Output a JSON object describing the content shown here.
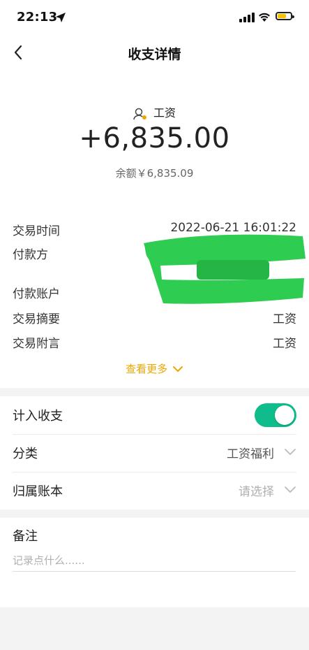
{
  "status": {
    "time": "22:13"
  },
  "nav": {
    "title": "收支详情"
  },
  "summary": {
    "category": "工资",
    "amount": "+6,835.00",
    "balance": "余额￥6,835.09"
  },
  "details": {
    "time_label": "交易时间",
    "time_value": "2022-06-21 16:01:22",
    "payer_label": "付款方",
    "payer_value": "",
    "account_label": "付款账户",
    "account_value": "",
    "summary_label": "交易摘要",
    "summary_value": "工资",
    "note_label": "交易附言",
    "note_value": "工资",
    "more": "查看更多"
  },
  "settings": {
    "income_label": "计入收支",
    "income_enabled": true,
    "category_label": "分类",
    "category_value": "工资福利",
    "book_label": "归属账本",
    "book_value": "请选择"
  },
  "remark": {
    "title": "备注",
    "placeholder": "记录点什么......",
    "value": ""
  },
  "colors": {
    "accent": "#f0a500",
    "toggle": "#0ebd8b",
    "redaction": "#2ecc50"
  }
}
